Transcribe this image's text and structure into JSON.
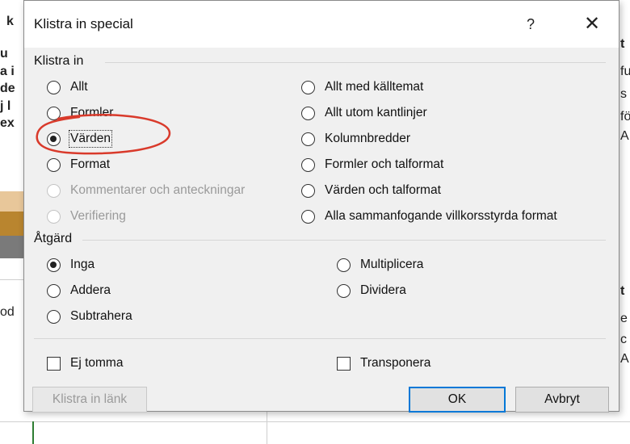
{
  "background": {
    "fragments_left": [
      "k",
      "u",
      "a i",
      "de",
      "j l",
      "ex",
      "od"
    ],
    "fragments_right": [
      "t",
      "fu",
      "s",
      "fö",
      "A",
      "t",
      "e",
      "c",
      "A"
    ]
  },
  "dialog": {
    "title": "Klistra in special",
    "help_label": "?",
    "close_label": "✕",
    "paste_group": {
      "label": "Klistra in",
      "left_options": [
        {
          "label": "Allt",
          "checked": false,
          "disabled": false
        },
        {
          "label": "Formler",
          "checked": false,
          "disabled": false
        },
        {
          "label": "Värden",
          "checked": true,
          "disabled": false
        },
        {
          "label": "Format",
          "checked": false,
          "disabled": false
        },
        {
          "label": "Kommentarer och anteckningar",
          "checked": false,
          "disabled": true
        },
        {
          "label": "Verifiering",
          "checked": false,
          "disabled": true
        }
      ],
      "right_options": [
        {
          "label": "Allt med källtemat",
          "checked": false
        },
        {
          "label": "Allt utom kantlinjer",
          "checked": false
        },
        {
          "label": "Kolumnbredder",
          "checked": false
        },
        {
          "label": "Formler och talformat",
          "checked": false
        },
        {
          "label": "Värden och talformat",
          "checked": false
        },
        {
          "label": "Alla sammanfogande villkorsstyrda format",
          "checked": false
        }
      ]
    },
    "operation_group": {
      "label": "Åtgärd",
      "left_options": [
        {
          "label": "Inga",
          "checked": true
        },
        {
          "label": "Addera",
          "checked": false
        },
        {
          "label": "Subtrahera",
          "checked": false
        }
      ],
      "right_options": [
        {
          "label": "Multiplicera",
          "checked": false
        },
        {
          "label": "Dividera",
          "checked": false
        }
      ]
    },
    "checkboxes": {
      "skip_blanks": {
        "label": "Ej tomma",
        "checked": false
      },
      "transpose": {
        "label": "Transponera",
        "checked": false
      }
    },
    "buttons": {
      "paste_link": "Klistra in länk",
      "ok": "OK",
      "cancel": "Avbryt"
    }
  },
  "colors": {
    "annotation_circle": "#d93a2b",
    "default_button_border": "#0078d7",
    "band_tan": "#e8c79a",
    "band_brown": "#b9852f",
    "band_gray": "#7a7a7a"
  }
}
